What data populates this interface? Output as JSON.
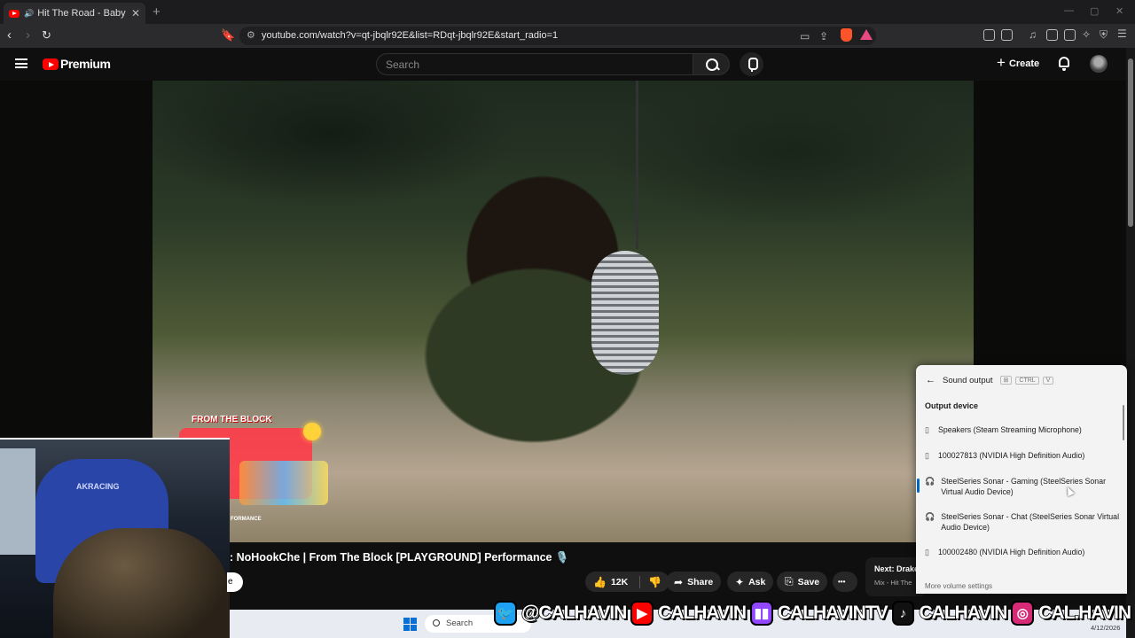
{
  "browser": {
    "tab_title": "Hit The Road - Baby Crash f/",
    "tab_close": "✕",
    "new_tab": "+",
    "url": "youtube.com/watch?v=qt-jbqlr92E&list=RDqt-jbqlr92E&start_radio=1"
  },
  "youtube": {
    "brand": "Premium",
    "search_placeholder": "Search",
    "create_label": "Create",
    "create_plus": "+"
  },
  "video": {
    "overlay_logo_top": "FROM THE BLOCK",
    "overlay_logo_bottom": "FORMANCE",
    "webcam_chair_text": "AKRACING",
    "title": ": NoHookChe | From The Block [PLAYGROUND] Performance 🎙️",
    "subscribe_fragment": "e",
    "likes": "12K",
    "share_label": "Share",
    "ask_label": "Ask",
    "save_label": "Save",
    "more_label": "•••",
    "next_title": "Next: Drake",
    "next_sub": "Mix - Hit The"
  },
  "sound_panel": {
    "title": "Sound output",
    "shortcut_1": "CTRL",
    "shortcut_2": "V",
    "section": "Output device",
    "devices": [
      "Speakers (Steam Streaming Microphone)",
      "100027813 (NVIDIA High Definition Audio)",
      "SteelSeries Sonar - Gaming (SteelSeries Sonar Virtual Audio Device)",
      "SteelSeries Sonar - Chat (SteelSeries Sonar Virtual Audio Device)",
      "100002480 (NVIDIA High Definition Audio)"
    ],
    "active_device_index": 2,
    "more": "More volume settings"
  },
  "taskbar": {
    "search": "Search",
    "date": "4/12/2026"
  },
  "social": {
    "twitter": "@CALHAVIN",
    "youtube": "CALHAVIN",
    "twitch": "CALHAVINTV",
    "tiktok": "CALHAVIN",
    "instagram": "CAL.HAVIN"
  },
  "colors": {
    "youtube_red": "#ff0000",
    "twitter_blue": "#1da1f2",
    "twitch_purple": "#9146ff",
    "instagram_pink": "#d62976",
    "accent_blue": "#0067c0"
  }
}
